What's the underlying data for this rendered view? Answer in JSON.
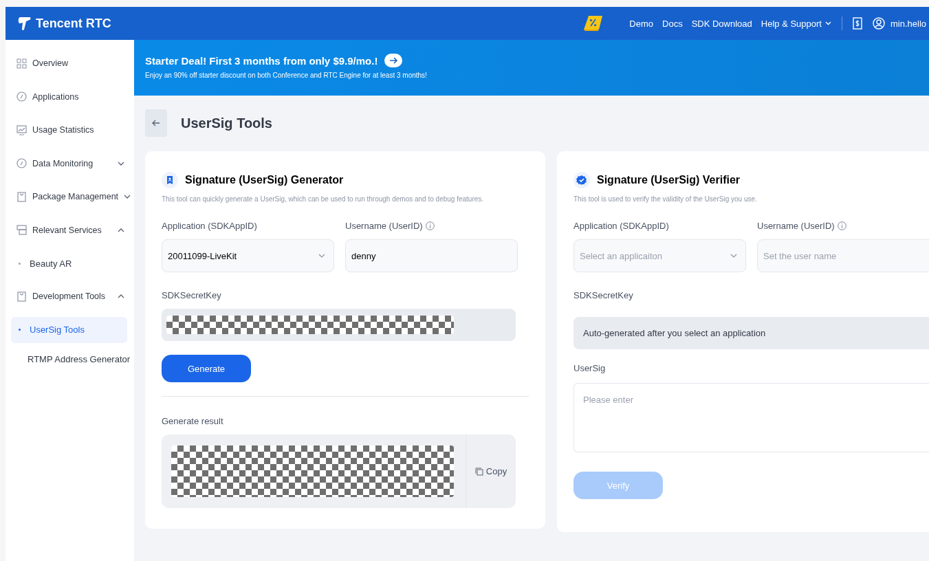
{
  "header": {
    "brand": "Tencent RTC",
    "nav_links": [
      {
        "label": "Demo",
        "kind": "link"
      },
      {
        "label": "Docs",
        "kind": "link"
      },
      {
        "label": "SDK Download",
        "kind": "link"
      },
      {
        "label": "Help & Support",
        "kind": "menu"
      }
    ],
    "user": "min.hello"
  },
  "sidebar": {
    "items": [
      {
        "label": "Overview",
        "selected": false
      },
      {
        "label": "Applications",
        "selected": false
      },
      {
        "label": "Usage Statistics",
        "selected": false
      },
      {
        "label": "Data Monitoring",
        "selected": false,
        "expanded": false
      },
      {
        "label": "Package Management",
        "selected": false,
        "expanded": false
      },
      {
        "label": "Relevant Services",
        "selected": false,
        "expanded": true,
        "children": [
          {
            "label": "Beauty AR",
            "selected": false
          }
        ]
      },
      {
        "label": "Development Tools",
        "selected": false,
        "expanded": true,
        "children": [
          {
            "label": "UserSig Tools",
            "selected": true
          },
          {
            "label": "RTMP Address Generator",
            "selected": false
          }
        ]
      }
    ]
  },
  "banner": {
    "title": "Starter Deal! First 3 months from only $9.9/mo.!",
    "subtitle": "Enjoy an 90% off starter discount on both Conference and RTC Engine for at least 3 months!"
  },
  "page": {
    "title": "UserSig Tools"
  },
  "generator": {
    "title": "Signature (UserSig) Generator",
    "description": "This tool can quickly generate a UserSig, which can be used to run through demos and to debug features.",
    "app_label": "Application (SDKAppID)",
    "app_value": "20011099-LiveKit",
    "user_label": "Username (UserID)",
    "user_value": "denny",
    "secret_label": "SDKSecretKey",
    "button": "Generate",
    "result_label": "Generate result",
    "copy": "Copy"
  },
  "verifier": {
    "title": "Signature (UserSig) Verifier",
    "description": "This tool is used to verify the validity of the UserSig you use.",
    "app_label": "Application (SDKAppID)",
    "app_placeholder": "Select an applicaiton",
    "user_label": "Username (UserID)",
    "user_placeholder": "Set the user name",
    "secret_label": "SDKSecretKey",
    "secret_value": "Auto-generated after you select an application",
    "usersig_label": "UserSig",
    "usersig_placeholder": "Please enter",
    "button": "Verify",
    "button_disabled": true
  }
}
